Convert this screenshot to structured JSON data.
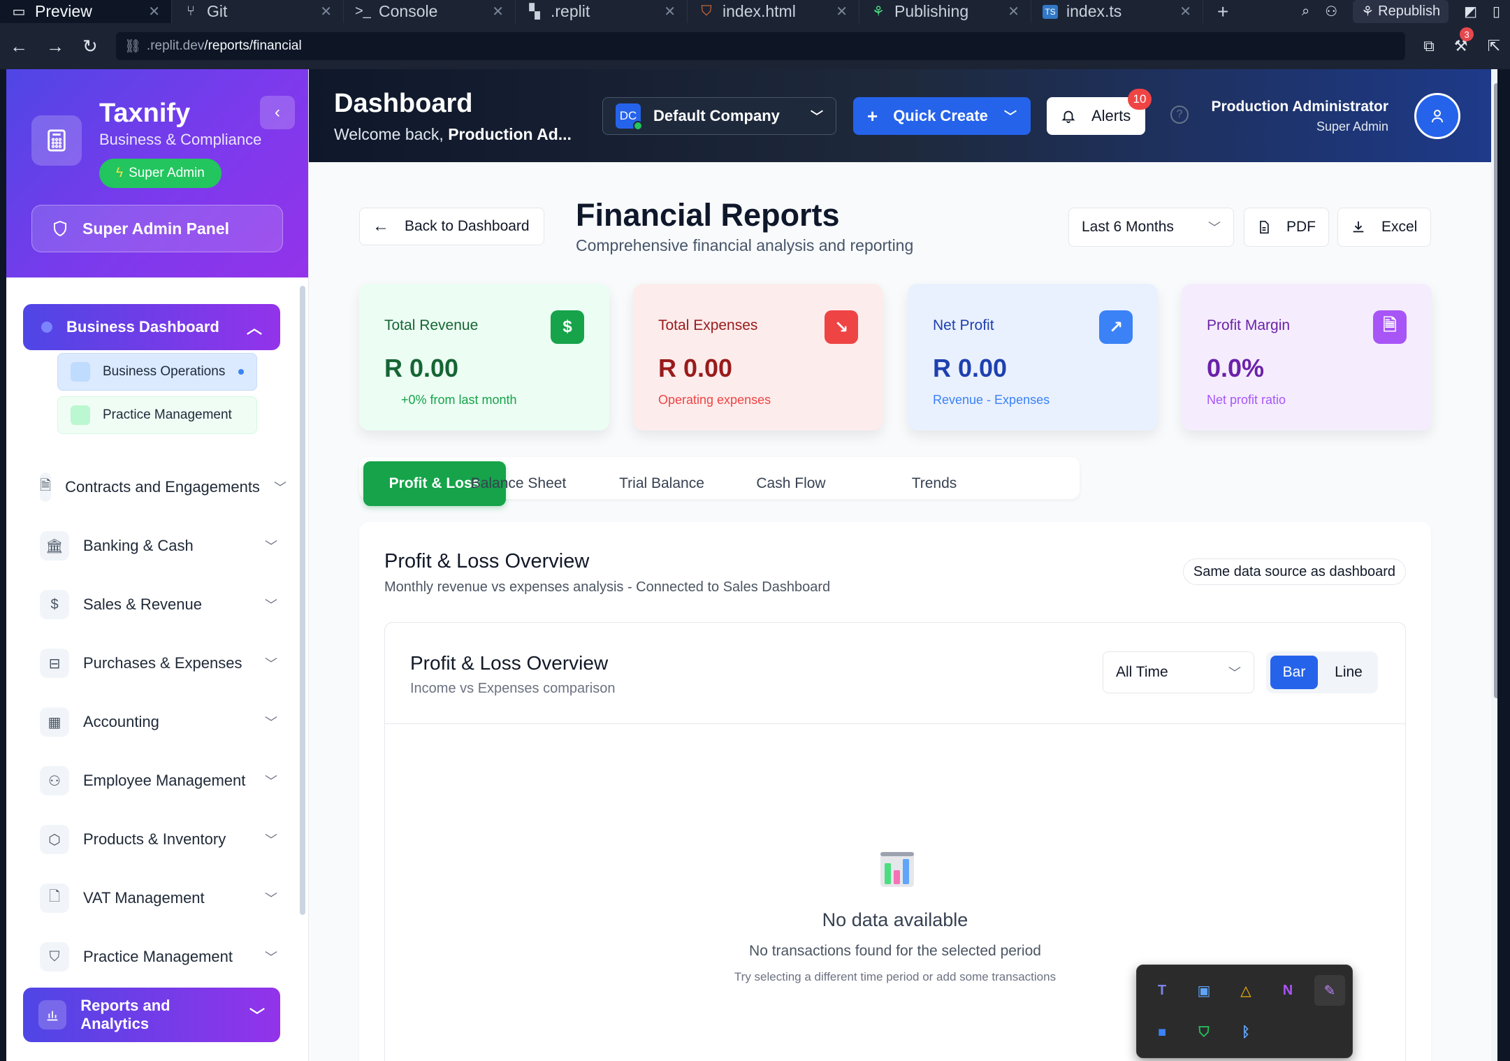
{
  "browser": {
    "tabs": [
      {
        "label": "Preview",
        "icon": "monitor-icon"
      },
      {
        "label": "Git",
        "icon": "git-icon"
      },
      {
        "label": "Console",
        "icon": "terminal-icon"
      },
      {
        "label": ".replit",
        "icon": "replit-icon"
      },
      {
        "label": "index.html",
        "icon": "html5-icon"
      },
      {
        "label": "Publishing",
        "icon": "publish-icon"
      },
      {
        "label": "index.ts",
        "icon": "typescript-icon"
      }
    ],
    "republish_label": "Republish",
    "url_host": ".replit.dev",
    "url_path": "/reports/financial",
    "notifications_count": "3"
  },
  "sidebar": {
    "brand_name": "Taxnify",
    "brand_sub": "Business & Compliance",
    "role_badge": "Super Admin",
    "panel_button": "Super Admin Panel",
    "active_group": "Business Dashboard",
    "sub_items": [
      {
        "label": "Business Operations",
        "color": "#dbeafe",
        "square": "#bfdbfe"
      },
      {
        "label": "Practice Management",
        "color": "#f0fdf4",
        "square": "#bbf7d0"
      }
    ],
    "items": [
      {
        "label": "Contracts and Engagements",
        "icon": "document-icon"
      },
      {
        "label": "Banking & Cash",
        "icon": "bank-icon"
      },
      {
        "label": "Sales & Revenue",
        "icon": "dollar-icon"
      },
      {
        "label": "Purchases & Expenses",
        "icon": "receipt-icon"
      },
      {
        "label": "Accounting",
        "icon": "calculator-icon"
      },
      {
        "label": "Employee Management",
        "icon": "users-icon"
      },
      {
        "label": "Products & Inventory",
        "icon": "package-icon"
      },
      {
        "label": "VAT Management",
        "icon": "file-icon"
      },
      {
        "label": "Practice Management",
        "icon": "shield-icon"
      }
    ],
    "reports_item": "Reports and Analytics"
  },
  "header": {
    "title": "Dashboard",
    "welcome_prefix": "Welcome back,",
    "welcome_name": "Production Ad...",
    "company_initials": "DC",
    "company_name": "Default Company",
    "quick_create": "Quick Create",
    "alerts_label": "Alerts",
    "alerts_count": "10",
    "user_name": "Production Administrator",
    "user_role": "Super Admin"
  },
  "page": {
    "back_label": "Back to Dashboard",
    "title": "Financial Reports",
    "subtitle": "Comprehensive financial analysis and reporting",
    "period": "Last 6 Months",
    "pdf_label": "PDF",
    "excel_label": "Excel"
  },
  "kpis": [
    {
      "label": "Total Revenue",
      "value": "R 0.00",
      "note": "+0% from last month",
      "icon": "dollar-icon",
      "bg": "#ecfdf3",
      "accent": "#16a34a",
      "value_color": "#166534",
      "label_color": "#166534"
    },
    {
      "label": "Total Expenses",
      "value": "R 0.00",
      "note": "Operating expenses",
      "icon": "trending-down-icon",
      "bg": "#fdecec",
      "accent": "#ef4444",
      "value_color": "#991b1b",
      "label_color": "#991b1b"
    },
    {
      "label": "Net Profit",
      "value": "R 0.00",
      "note": "Revenue - Expenses",
      "icon": "trending-up-icon",
      "bg": "#eaf1fe",
      "accent": "#3b82f6",
      "value_color": "#1e40af",
      "label_color": "#1e40af"
    },
    {
      "label": "Profit Margin",
      "value": "0.0%",
      "note": "Net profit ratio",
      "icon": "document-icon",
      "bg": "#f5edfe",
      "accent": "#a855f7",
      "value_color": "#6b21a8",
      "label_color": "#6b21a8"
    }
  ],
  "report_tabs": [
    "Profit & Loss",
    "Balance Sheet",
    "Trial Balance",
    "Cash Flow",
    "Trends"
  ],
  "active_tab": "Profit & Loss",
  "overview": {
    "title": "Profit & Loss Overview",
    "subtitle": "Monthly revenue vs expenses analysis - Connected to Sales Dashboard",
    "source_badge": "Same data source as dashboard"
  },
  "chart_panel": {
    "title": "Profit & Loss Overview",
    "subtitle": "Income vs Expenses comparison",
    "range": "All Time",
    "toggle": [
      "Bar",
      "Line"
    ],
    "active_toggle": "Bar",
    "empty_title": "No data available",
    "empty_sub": "No transactions found for the selected period",
    "empty_hint": "Try selecting a different time period or add some transactions"
  },
  "tray_icons": [
    "teams-icon",
    "window-icon",
    "drive-icon",
    "onenote-icon",
    "pen-icon",
    "app-icon",
    "security-icon",
    "bluetooth-icon"
  ]
}
